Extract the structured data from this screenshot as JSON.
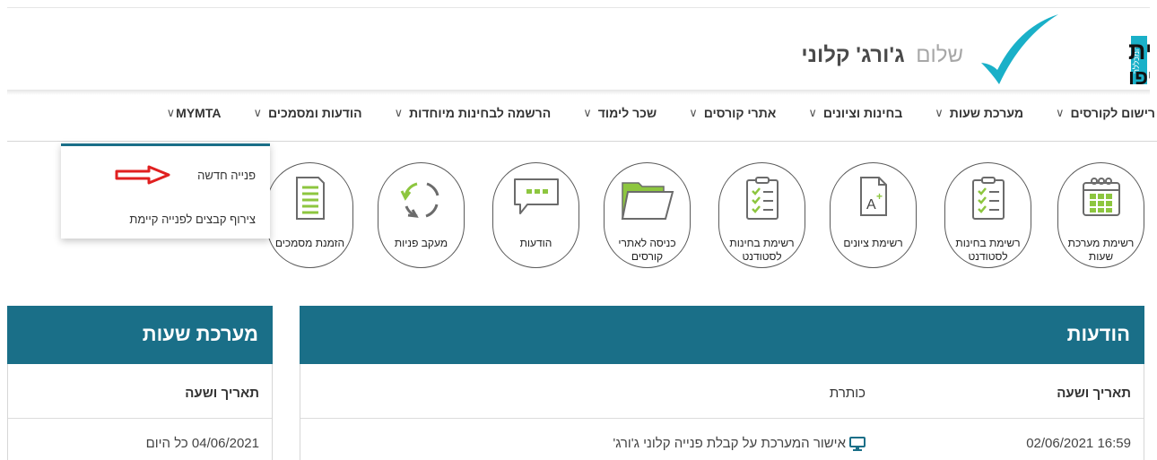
{
  "header": {
    "logo_line1": "האקדמית",
    "logo_line2": "תל־אביב-יפו",
    "logo_side": "המכללה",
    "greeting_prefix": "שלום",
    "user_name": "ג'ורג' קלוני"
  },
  "nav": [
    {
      "label": "רישום לקורסים",
      "chevron": "∨"
    },
    {
      "label": "מערכת שעות",
      "chevron": "∨"
    },
    {
      "label": "בחינות וציונים",
      "chevron": "∨"
    },
    {
      "label": "אתרי קורסים",
      "chevron": "∨"
    },
    {
      "label": "שכר לימוד",
      "chevron": "∨"
    },
    {
      "label": "הרשמה לבחינות מיוחדות",
      "chevron": "∨"
    },
    {
      "label": "הודעות ומסמכים",
      "chevron": "∨"
    },
    {
      "label": "MYMTA",
      "chevron": "∨"
    }
  ],
  "icons": [
    {
      "label": "רשימת מערכת שעות",
      "icon": "calendar-icon"
    },
    {
      "label": "רשימת בחינות לסטודנט",
      "icon": "clipboard-checklist-icon"
    },
    {
      "label": "רשימת ציונים",
      "icon": "grade-document-icon"
    },
    {
      "label": "רשימת בחינות לסטודנט",
      "icon": "clipboard-checklist-icon"
    },
    {
      "label": "כניסה לאתרי קורסים",
      "icon": "folder-icon"
    },
    {
      "label": "הודעות",
      "icon": "chat-bubble-icon"
    },
    {
      "label": "מעקב פניות",
      "icon": "refresh-cycle-icon"
    },
    {
      "label": "הזמנת מסמכים",
      "icon": "document-list-icon"
    }
  ],
  "dropdown": {
    "items": [
      "פנייה חדשה",
      "צירוף קבצים לפנייה קיימת"
    ]
  },
  "messages_panel": {
    "title": "הודעות",
    "col_date": "תאריך ושעה",
    "col_subject": "כותרת",
    "rows": [
      {
        "date": "16:59 02/06/2021",
        "subject": "אישור המערכת על קבלת פנייה קלוני ג'ורג'"
      }
    ]
  },
  "schedule_panel": {
    "title": "מערכת שעות",
    "col_date": "תאריך ושעה",
    "rows": [
      {
        "date": "04/06/2021 כל היום"
      }
    ]
  },
  "colors": {
    "brand_teal": "#1a6f88",
    "icon_green": "#8dc63f",
    "logo_cyan": "#1ab0c8",
    "arrow_red": "#e02020"
  }
}
